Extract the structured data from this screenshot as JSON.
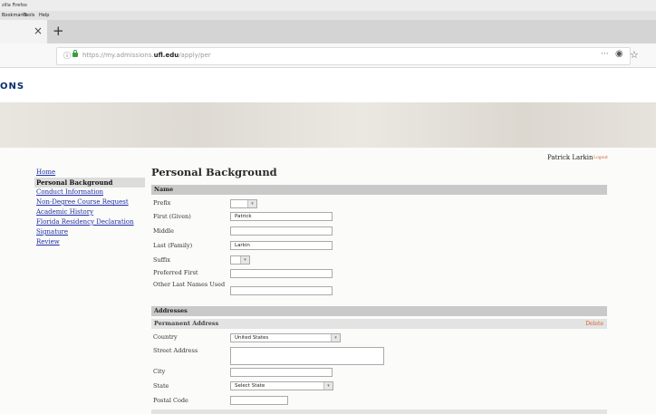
{
  "browser": {
    "title_fragment": "zilla Firefox",
    "menu": [
      "Bookmarks",
      "Tools",
      "Help"
    ],
    "tab_close": "×",
    "new_tab": "+",
    "url_prefix": "https://my.admissions.",
    "url_domain": "ufl.edu",
    "url_path": "/apply/per",
    "more_label": "···"
  },
  "site": {
    "title_fragment": "ONS"
  },
  "user": {
    "name": "Patrick Larkin",
    "logout_label": "Logout"
  },
  "nav": {
    "items": [
      {
        "label": "Home"
      },
      {
        "label": "Personal Background"
      },
      {
        "label": "Conduct Information"
      },
      {
        "label": "Non-Degree Course Request"
      },
      {
        "label": "Academic History"
      },
      {
        "label": "Florida Residency Declaration"
      },
      {
        "label": "Signature"
      },
      {
        "label": "Review"
      }
    ]
  },
  "page": {
    "title": "Personal Background",
    "name_section": {
      "heading": "Name",
      "prefix_label": "Prefix",
      "first_label": "First (Given)",
      "first_value": "Patrick",
      "middle_label": "Middle",
      "middle_value": "",
      "last_label": "Last (Family)",
      "last_value": "Larkin",
      "suffix_label": "Suffix",
      "preferred_label": "Preferred First",
      "preferred_value": "",
      "other_last_label": "Other Last Names Used",
      "other_last_value": ""
    },
    "addresses": {
      "heading": "Addresses",
      "permanent_heading": "Permanent Address",
      "delete_label": "Delete",
      "country_label": "Country",
      "country_value": "United States",
      "street_label": "Street Address",
      "city_label": "City",
      "state_label": "State",
      "state_value": "Select State",
      "postal_label": "Postal Code"
    }
  },
  "colors": {
    "link": "#1f2fa8",
    "delete": "#d2622a",
    "section_bar": "#c9c9c9",
    "brand": "#0a2d6e",
    "lock": "#3a9d3a"
  }
}
